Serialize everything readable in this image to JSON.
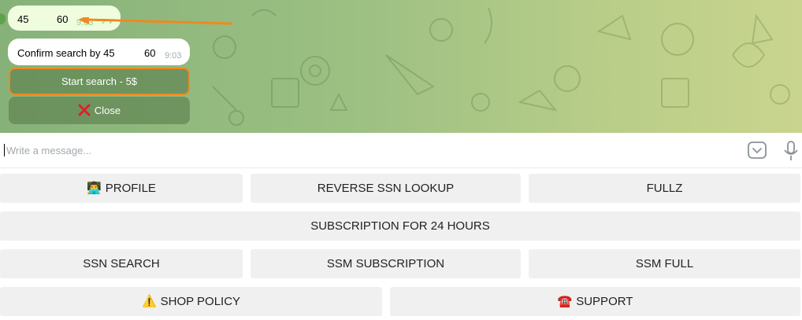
{
  "chat": {
    "outgoing": {
      "part1": "45",
      "part2": "60",
      "time": "9:03",
      "ticks": "✓✓"
    },
    "incoming": {
      "text": "Confirm search by 45",
      "num": "60",
      "time": "9:03"
    },
    "inline_buttons": {
      "start_label": "Start search - 5$",
      "close_label": "Close"
    }
  },
  "input": {
    "placeholder": "Write a message..."
  },
  "keyboard": {
    "row1": {
      "profile": {
        "icon": "👨‍💻",
        "label": "PROFILE"
      },
      "reverse": "REVERSE SSN LOOKUP",
      "fullz": "FULLZ"
    },
    "row2": {
      "subscription": "SUBSCRIPTION FOR 24 HOURS"
    },
    "row3": {
      "ssn_search": "SSN SEARCH",
      "ssm_subscription": "SSM SUBSCRIPTION",
      "ssm_full": "SSM FULL"
    },
    "row4": {
      "shop_policy": {
        "icon": "⚠️",
        "label": "SHOP POLICY"
      },
      "support": {
        "icon": "☎️",
        "label": "SUPPORT"
      }
    }
  },
  "colors": {
    "bg_start": "#86b27a",
    "bg_end": "#c9d58e",
    "outgoing_bubble": "#effdde",
    "highlight": "#f0891f",
    "keyboard_button": "#f0f0f0"
  }
}
